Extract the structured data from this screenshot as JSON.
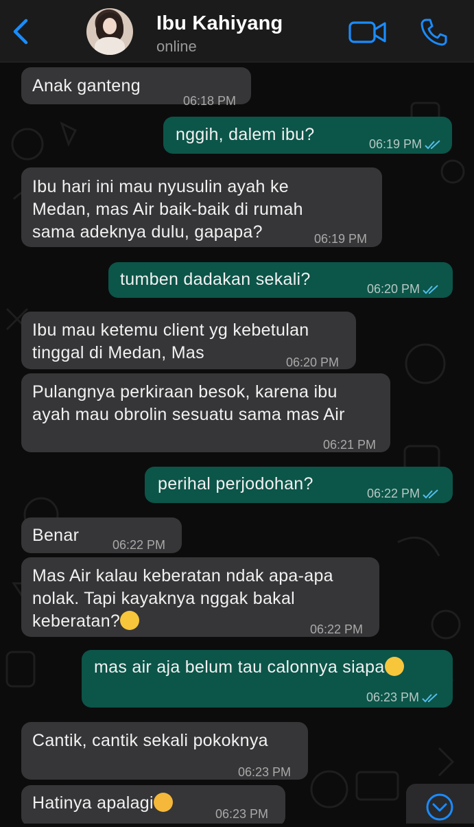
{
  "header": {
    "contact_name": "Ibu Kahiyang",
    "status": "online",
    "back_icon": "chevron-left-icon",
    "video_icon": "video-camera-icon",
    "call_icon": "phone-icon",
    "accent_color": "#1a8cff"
  },
  "colors": {
    "incoming_bubble": "#363638",
    "outgoing_bubble": "#0c5549",
    "read_ticks": "#53bdeb",
    "background": "#0c0c0c"
  },
  "messages": [
    {
      "dir": "in",
      "text": "Anak ganteng",
      "time": "06:18 PM"
    },
    {
      "dir": "out",
      "text": "nggih, dalem ibu?",
      "time": "06:19 PM",
      "read": true
    },
    {
      "dir": "in",
      "text": "Ibu hari ini mau nyusulin ayah ke\nMedan, mas Air baik-baik di rumah\nsama adeknya dulu, gapapa?",
      "time": "06:19 PM"
    },
    {
      "dir": "out",
      "text": "tumben dadakan sekali?",
      "time": "06:20 PM",
      "read": true
    },
    {
      "dir": "in",
      "text": "Ibu mau ketemu client yg kebetulan\ntinggal di Medan, Mas",
      "time": "06:20 PM"
    },
    {
      "dir": "in",
      "text": "Pulangnya perkiraan besok, karena ibu\nayah mau obrolin sesuatu sama mas Air",
      "time": "06:21 PM"
    },
    {
      "dir": "out",
      "text": "perihal perjodohan?",
      "time": "06:22 PM",
      "read": true
    },
    {
      "dir": "in",
      "text": "Benar",
      "time": "06:22 PM"
    },
    {
      "dir": "in",
      "text": "Mas Air kalau keberatan ndak apa-apa\nnolak. Tapi kayaknya nggak bakal\nkeberatan?",
      "time": "06:22 PM",
      "emoji": "hand-over-mouth-emoji"
    },
    {
      "dir": "out",
      "text": "mas air aja belum tau calonnya siapa",
      "time": "06:23 PM",
      "read": true,
      "emoji": "smiling-face-emoji"
    },
    {
      "dir": "in",
      "text": "Cantik, cantik sekali pokoknya",
      "time": "06:23 PM"
    },
    {
      "dir": "in",
      "text": "Hatinya apalagi",
      "time": "06:23 PM",
      "emoji": "smiling-face-with-hearts-emoji"
    }
  ],
  "scroll_button": {
    "icon": "chevron-down-circle-icon"
  }
}
